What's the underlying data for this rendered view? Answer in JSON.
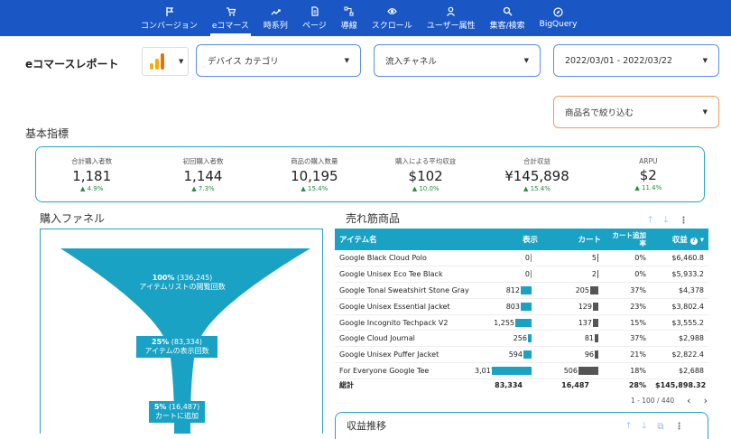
{
  "nav": {
    "items": [
      {
        "icon": "flag-icon",
        "label": "コンバージョン",
        "active": false
      },
      {
        "icon": "cart-icon",
        "label": "eコマース",
        "active": true
      },
      {
        "icon": "trend-icon",
        "label": "時系列",
        "active": false
      },
      {
        "icon": "page-icon",
        "label": "ページ",
        "active": false
      },
      {
        "icon": "flow-icon",
        "label": "導線",
        "active": false
      },
      {
        "icon": "eye-icon",
        "label": "スクロール",
        "active": false
      },
      {
        "icon": "user-icon",
        "label": "ユーザー属性",
        "active": false
      },
      {
        "icon": "search-icon",
        "label": "集客/検索",
        "active": false
      },
      {
        "icon": "compass-icon",
        "label": "BigQuery",
        "active": false
      }
    ]
  },
  "header": {
    "title": "eコマースレポート"
  },
  "filters": {
    "device": "デバイス カテゴリ",
    "channel": "流入チャネル",
    "date_range": "2022/03/01 - 2022/03/22",
    "product_filter": "商品名で絞り込む"
  },
  "kpi_section": {
    "title": "基本指標"
  },
  "kpis": [
    {
      "label": "合計購入者数",
      "value": "1,181",
      "delta": "4.9%"
    },
    {
      "label": "初回購入者数",
      "value": "1,144",
      "delta": "7.3%"
    },
    {
      "label": "商品の購入数量",
      "value": "10,195",
      "delta": "15.4%"
    },
    {
      "label": "購入による平均収益",
      "value": "$102",
      "delta": "10.0%"
    },
    {
      "label": "合計収益",
      "value": "¥145,898",
      "delta": "15.4%"
    },
    {
      "label": "ARPU",
      "value": "$2",
      "delta": "11.4%"
    }
  ],
  "funnel": {
    "title": "購入ファネル",
    "stages": [
      {
        "pct": "100%",
        "count": "(336,245)",
        "label": "アイテムリストの閲覧回数",
        "share": 1.0
      },
      {
        "pct": "25%",
        "count": "(83,334)",
        "label": "アイテムの表示回数",
        "share": 0.25
      },
      {
        "pct": "5%",
        "count": "(16,487)",
        "label": "カートに追加",
        "share": 0.05
      }
    ]
  },
  "products": {
    "title": "売れ筋商品",
    "columns": {
      "item": "アイテム名",
      "views": "表示",
      "cart": "カート",
      "rate": "カート追加率",
      "revenue": "収益"
    },
    "rows": [
      {
        "name": "Google Black Cloud Polo",
        "views": "0",
        "cart": "5",
        "rate": "0%",
        "revenue": "$6,460.8",
        "views_n": 0,
        "cart_n": 5
      },
      {
        "name": "Google Unisex Eco Tee Black",
        "views": "0",
        "cart": "2",
        "rate": "0%",
        "revenue": "$5,933.2",
        "views_n": 0,
        "cart_n": 2
      },
      {
        "name": "Google Tonal Sweatshirt Stone Gray",
        "views": "812",
        "cart": "205",
        "rate": "37%",
        "revenue": "$4,378",
        "views_n": 812,
        "cart_n": 205
      },
      {
        "name": "Google Unisex Essential Jacket",
        "views": "803",
        "cart": "129",
        "rate": "23%",
        "revenue": "$3,802.4",
        "views_n": 803,
        "cart_n": 129
      },
      {
        "name": "Google Incognito Techpack V2",
        "views": "1,255",
        "cart": "137",
        "rate": "15%",
        "revenue": "$3,555.2",
        "views_n": 1255,
        "cart_n": 137
      },
      {
        "name": "Google Cloud Journal",
        "views": "256",
        "cart": "81",
        "rate": "37%",
        "revenue": "$2,988",
        "views_n": 256,
        "cart_n": 81
      },
      {
        "name": "Google Unisex Puffer Jacket",
        "views": "594",
        "cart": "96",
        "rate": "21%",
        "revenue": "$2,822.4",
        "views_n": 594,
        "cart_n": 96
      },
      {
        "name": "For Everyone Google Tee",
        "views": "3,017",
        "cart": "506",
        "rate": "18%",
        "revenue": "$2,688",
        "views_n": 3017,
        "cart_n": 506
      }
    ],
    "total": {
      "label": "総計",
      "views": "83,334",
      "cart": "16,487",
      "rate": "28%",
      "revenue": "$145,898.32"
    },
    "pager": "1 - 100 / 440"
  },
  "revenue_trend": {
    "title": "収益推移"
  },
  "colors": {
    "nav_bg": "#1a57c4",
    "accent": "#1aa2c4",
    "bar_gray": "#555555",
    "delta_green": "#1e8e3e"
  }
}
